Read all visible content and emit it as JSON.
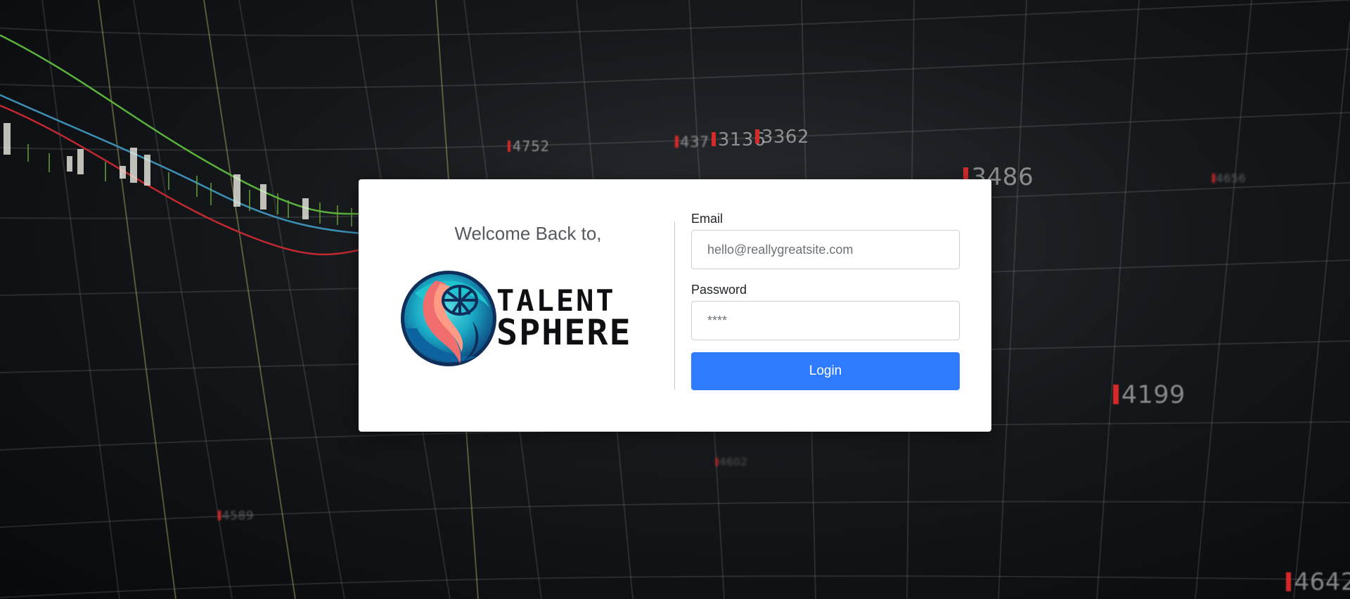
{
  "background": {
    "ticker_values": [
      "4752",
      "437",
      "3136",
      "3362",
      "3486",
      "4656",
      "4199",
      "4602",
      "4589",
      "4642"
    ]
  },
  "login": {
    "welcome_text": "Welcome Back to,",
    "brand": {
      "line1": "TALENT",
      "line2": "SPHERE"
    },
    "email": {
      "label": "Email",
      "placeholder": "hello@reallygreatsite.com"
    },
    "password": {
      "label": "Password",
      "placeholder": "****"
    },
    "login_button": "Login"
  },
  "colors": {
    "primary_button": "#2f7bff",
    "card_background": "#ffffff",
    "logo_teal": "#1bb3c7",
    "logo_coral": "#f26d6d",
    "logo_navy": "#0f2e5a"
  }
}
